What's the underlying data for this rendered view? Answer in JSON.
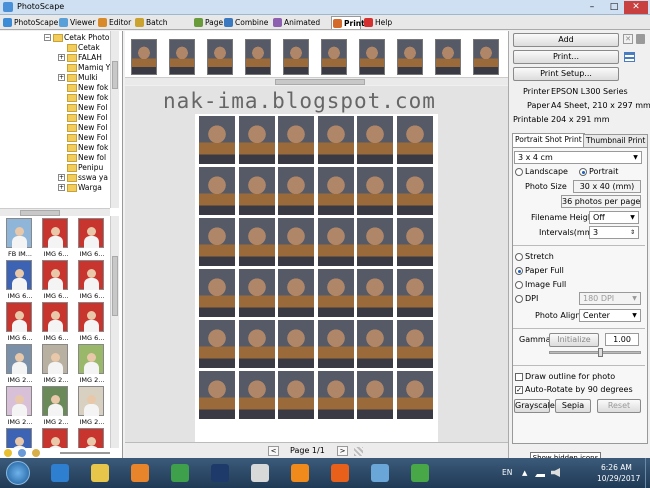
{
  "window": {
    "title": "PhotoScape",
    "minimize_glyph": "–",
    "maximize_glyph": "□",
    "close_glyph": "✕"
  },
  "tabs": [
    {
      "label": "PhotoScape",
      "icon": "photoscape-icon",
      "color": "#3c8bd6"
    },
    {
      "label": "Viewer",
      "icon": "viewer-icon",
      "color": "#5aa0d8"
    },
    {
      "label": "Editor",
      "icon": "editor-icon",
      "color": "#d88a2a"
    },
    {
      "label": "Batch Editor",
      "icon": "batch-editor-icon",
      "color": "#c9a22f"
    },
    {
      "label": "Page",
      "icon": "page-icon",
      "color": "#6a9b3b"
    },
    {
      "label": "Combine",
      "icon": "combine-icon",
      "color": "#3a78c0"
    },
    {
      "label": "Animated GIF",
      "icon": "animated-gif-icon",
      "color": "#8c5fb0"
    },
    {
      "label": "Print",
      "icon": "print-icon",
      "color": "#d46a2a"
    },
    {
      "label": "Help",
      "icon": "help-icon",
      "color": "#d43030"
    }
  ],
  "folder_tree": {
    "items": [
      {
        "label": "Cetak Photo",
        "expander": "−"
      },
      {
        "label": "Cetak",
        "expander": ""
      },
      {
        "label": "FALAH",
        "expander": "+"
      },
      {
        "label": "Mamiq Y",
        "expander": ""
      },
      {
        "label": "Mulki",
        "expander": "+"
      },
      {
        "label": "New fok",
        "expander": ""
      },
      {
        "label": "New fok",
        "expander": ""
      },
      {
        "label": "New Fol",
        "expander": ""
      },
      {
        "label": "New Fol",
        "expander": ""
      },
      {
        "label": "New Fol",
        "expander": ""
      },
      {
        "label": "New Fol",
        "expander": ""
      },
      {
        "label": "New fok",
        "expander": ""
      },
      {
        "label": "New fol",
        "expander": ""
      },
      {
        "label": "Penipu",
        "expander": ""
      },
      {
        "label": "sswa ya",
        "expander": "+"
      },
      {
        "label": "Warga",
        "expander": "+"
      }
    ]
  },
  "thumbnails": [
    {
      "caption": "FB IM...",
      "bg": "#8fb6d8"
    },
    {
      "caption": "IMG 6...",
      "bg": "#c7352e"
    },
    {
      "caption": "IMG 6...",
      "bg": "#c7352e"
    },
    {
      "caption": "IMG 6...",
      "bg": "#3d63b4"
    },
    {
      "caption": "IMG 6...",
      "bg": "#c7352e"
    },
    {
      "caption": "IMG 6...",
      "bg": "#c7352e"
    },
    {
      "caption": "IMG 6...",
      "bg": "#c7352e"
    },
    {
      "caption": "IMG 6...",
      "bg": "#c7352e"
    },
    {
      "caption": "IMG 6...",
      "bg": "#c7352e"
    },
    {
      "caption": "IMG 2...",
      "bg": "#7a8fa8"
    },
    {
      "caption": "IMG 2...",
      "bg": "#b8b0a0"
    },
    {
      "caption": "IMG 2...",
      "bg": "#9ab86a"
    },
    {
      "caption": "IMG 2...",
      "bg": "#d8c0d8"
    },
    {
      "caption": "IMG 2...",
      "bg": "#6a8a5a"
    },
    {
      "caption": "IMG 2...",
      "bg": "#d8d0c0"
    },
    {
      "caption": "",
      "bg": "#3d63b4"
    },
    {
      "caption": "",
      "bg": "#c7352e"
    },
    {
      "caption": "",
      "bg": "#c7352e"
    }
  ],
  "top_strip": {
    "count": 11
  },
  "canvas": {
    "watermark": "nak-ima.blogspot.com",
    "page_label": "Page 1/1",
    "prev_glyph": "<",
    "next_glyph": ">"
  },
  "right_panel": {
    "add_label": "Add",
    "print_label": "Print...",
    "print_setup_label": "Print Setup...",
    "printer_label": "Printer",
    "printer_value": "EPSON L300 Series",
    "paper_label": "Paper",
    "paper_value": "A4 Sheet, 210 x 297 mm",
    "printable_label": "Printable",
    "printable_value": "204 x 291 mm",
    "tab_portrait": "Portrait Shot Print",
    "tab_thumbnail": "Thumbnail Print",
    "size_select": "3 x 4 cm",
    "landscape_label": "Landscape",
    "portrait_label": "Portrait",
    "photo_size_label": "Photo Size",
    "photo_size_value": "30 x 40 (mm)",
    "photos_per_page": "36 photos per page",
    "filename_height_label": "Filename Height",
    "filename_height_value": "Off",
    "intervals_label": "Intervals(mm)",
    "intervals_value": "3",
    "stretch_label": "Stretch",
    "paper_full_label": "Paper Full",
    "image_full_label": "Image Full",
    "dpi_label": "DPI",
    "dpi_value": "180 DPI",
    "photo_align_label": "Photo Align",
    "photo_align_value": "Center",
    "gamma_label": "Gamma",
    "initialize_label": "Initialize",
    "gamma_value": "1.00",
    "gamma_level": 0.55,
    "draw_outline_label": "Draw outline for photo",
    "auto_rotate_label": "Auto-Rotate by 90 degrees",
    "grayscale_label": "Grayscale",
    "sepia_label": "Sepia",
    "reset_label": "Reset"
  },
  "tooltip": "Show hidden icons",
  "taskbar": {
    "apps": [
      {
        "name": "internet-explorer",
        "color": "#2f7fd0"
      },
      {
        "name": "file-explorer",
        "color": "#e8c64a"
      },
      {
        "name": "media-player",
        "color": "#e8842a"
      },
      {
        "name": "chrome",
        "color": "#3ea04a"
      },
      {
        "name": "photoshop",
        "color": "#1d3a6a"
      },
      {
        "name": "photoscape",
        "color": "#d8d8d8"
      },
      {
        "name": "vlc",
        "color": "#f08a1a"
      },
      {
        "name": "firefox",
        "color": "#e8601a"
      },
      {
        "name": "paint",
        "color": "#6aa6d8"
      },
      {
        "name": "app-green",
        "color": "#48a848"
      }
    ],
    "lang": "EN",
    "time": "6:26 AM",
    "date": "10/29/2017"
  }
}
